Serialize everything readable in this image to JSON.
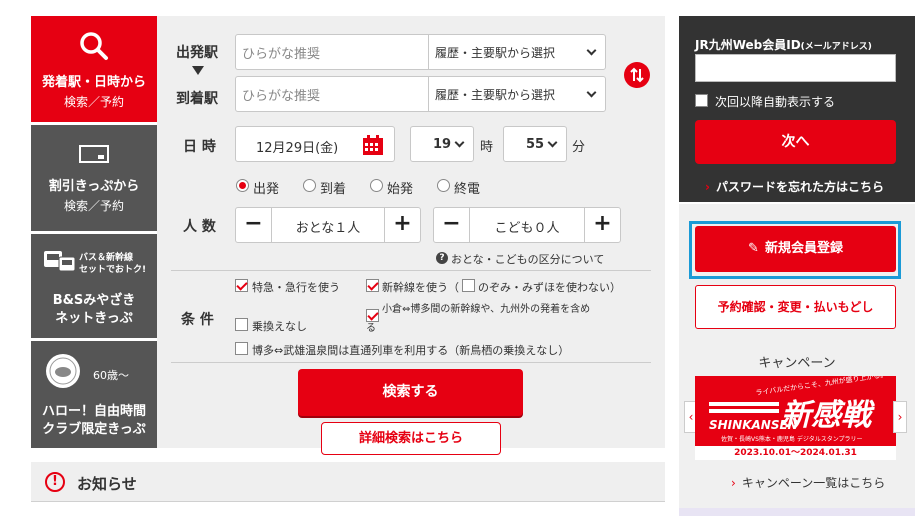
{
  "colors": {
    "brand_red": "#e60012",
    "dark_gray": "#333333",
    "tab_gray": "#555555",
    "panel_bg": "#efefef",
    "highlight_blue": "#1a9ad6"
  },
  "tabs": [
    {
      "line1": "発着駅・日時から",
      "line2": "検索／予約",
      "icon": "search-icon"
    },
    {
      "line1": "割引きっぷから",
      "line2": "検索／予約",
      "icon": "ticket-icon"
    },
    {
      "badge1": "バス＆新幹線",
      "badge2": "セットでおトク!",
      "line1": "B&Sみやざき",
      "line2": "ネットきっぷ",
      "icon": "bus-train-icon"
    },
    {
      "badge1": "60歳〜",
      "line1": "ハロー！自由時間",
      "line2": "クラブ限定きっぷ",
      "icon": "club-logo-icon"
    }
  ],
  "search": {
    "departure_label": "出発駅",
    "arrival_label": "到着駅",
    "departure_placeholder": "ひらがな推奨",
    "arrival_placeholder": "ひらがな推奨",
    "station_select": "履歴・主要駅から選択",
    "datetime_label": "日 時",
    "date_value": "12月29日(金)",
    "hour_value": "19",
    "hour_unit": "時",
    "minute_value": "55",
    "minute_unit": "分",
    "time_options": [
      "出発",
      "到着",
      "始発",
      "終電"
    ],
    "time_selected": "出発",
    "people_label": "人 数",
    "adult_value": "おとな１人",
    "child_value": "こども０人",
    "minus": "−",
    "plus": "+",
    "people_help": "おとな・こどもの区分について",
    "conditions_label": "条 件",
    "cond_express": "特急・急行を使う",
    "cond_shinkansen": "新幹線を使う（",
    "cond_nozomi": "のぞみ・みずほを使わない）",
    "cond_kokura_line1": "小倉⇔博多間の新幹線や、九州外の発着を含め",
    "cond_kokura_line2": "る",
    "cond_transfer": "乗換えなし",
    "cond_takeo": "博多⇔武雄温泉間は直通列車を利用する（新鳥栖の乗換えなし）",
    "search_button": "検索する",
    "detail_button": "詳細検索はこちら"
  },
  "notice": {
    "title": "お知らせ"
  },
  "login": {
    "id_label": "JR九州Web会員ID",
    "id_label_sub": "(メールアドレス)",
    "auto_show": "次回以降自動表示する",
    "next_button": "次へ",
    "forgot_password": "パスワードを忘れた方はこちら",
    "register_button": "新規会員登録",
    "reservation_button": "予約確認・変更・払いもどし"
  },
  "campaign": {
    "heading": "キャンペーン",
    "banner_small": "ライバルだからこそ、九州が盛り上がる。",
    "banner_title": "新感戦",
    "banner_en": "SHINKANSEN",
    "banner_sub": "佐賀・長崎VS熊本・鹿児島 デジタルスタンプラリー",
    "banner_dates": "2023.10.01〜2024.01.31",
    "list_link": "キャンペーン一覧はこちら"
  }
}
